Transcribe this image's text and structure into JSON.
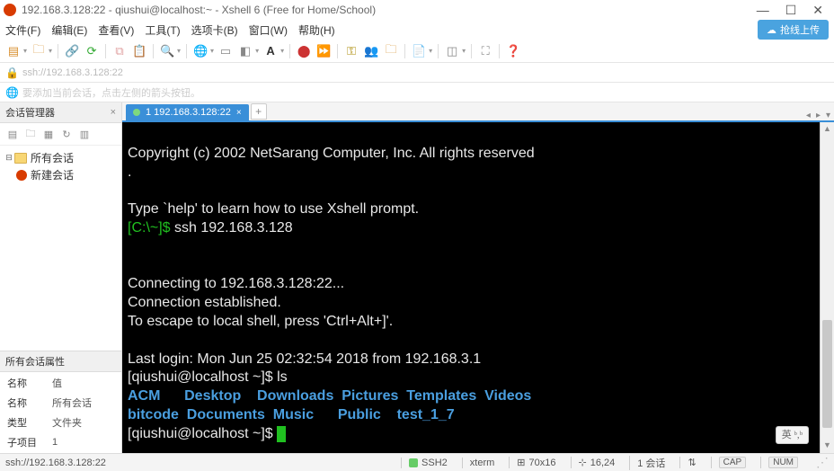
{
  "window": {
    "title": "192.168.3.128:22 - qiushui@localhost:~ - Xshell 6 (Free for Home/School)"
  },
  "menu": {
    "file": "文件(F)",
    "edit": "编辑(E)",
    "view": "查看(V)",
    "tools": "工具(T)",
    "tabcards": "选项卡(B)",
    "window": "窗口(W)",
    "help": "帮助(H)",
    "upload": "抢线上传"
  },
  "addr": {
    "text": "ssh://192.168.3.128:22"
  },
  "hint": {
    "text": "要添加当前会话，点击左侧的箭头按钮。"
  },
  "sidebar": {
    "title": "会话管理器",
    "tree": {
      "root": "所有会话",
      "new_session": "新建会话"
    },
    "props_title": "所有会话属性",
    "props": {
      "name_k": "名称",
      "name_v": "值",
      "p1k": "名称",
      "p1v": "所有会话",
      "p2k": "类型",
      "p2v": "文件夹",
      "p3k": "子项目",
      "p3v": "1"
    }
  },
  "tabs": {
    "t1": "1 192.168.3.128:22"
  },
  "term": {
    "l1": "Copyright (c) 2002 NetSarang Computer, Inc. All rights reserved",
    "l1b": ".",
    "blank": " ",
    "l2": "Type `help' to learn how to use Xshell prompt.",
    "p1a": "[C:\\~]$ ",
    "p1b": "ssh 192.168.3.128",
    "l3": "Connecting to 192.168.3.128:22...",
    "l4": "Connection established.",
    "l5": "To escape to local shell, press 'Ctrl+Alt+]'.",
    "l6": "Last login: Mon Jun 25 02:32:54 2018 from 192.168.3.1",
    "p2": "[qiushui@localhost ~]$ ls",
    "ls1": "ACM      Desktop    Downloads  Pictures  Templates  Videos",
    "ls2": "bitcode  Documents  Music      Public    test_1_7",
    "p3": "[qiushui@localhost ~]$ "
  },
  "ime": "英 ᵇ,ᵇ",
  "status": {
    "left": "ssh://192.168.3.128:22",
    "ssh": "SSH2",
    "term_type": "xterm",
    "size": "70x16",
    "pos": "16,24",
    "sess": "1 会话",
    "cap": "CAP",
    "num": "NUM",
    "arrows": "⇅"
  }
}
